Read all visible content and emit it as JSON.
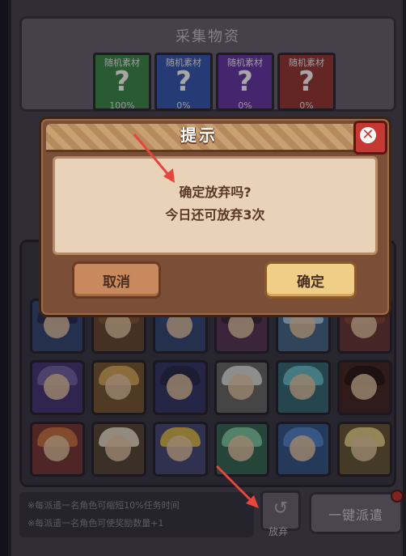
{
  "header": {
    "title": "采集物资",
    "materials": [
      {
        "label": "随机素材",
        "percent": "100%",
        "color": "#3f8a4e"
      },
      {
        "label": "随机素材",
        "percent": "0%",
        "color": "#3b59b5"
      },
      {
        "label": "随机素材",
        "percent": "0%",
        "color": "#6a3aa8"
      },
      {
        "label": "随机素材",
        "percent": "0%",
        "color": "#9a3a3a"
      }
    ]
  },
  "dialog": {
    "title": "提示",
    "message": "确定放弃吗?",
    "sub_message": "今日还可放弃3次",
    "cancel_label": "取消",
    "confirm_label": "确定"
  },
  "footer": {
    "notes": [
      "※每派遣一名角色可缩短10%任务时间",
      "※每派遣一名角色可使奖励数量+1"
    ],
    "abandon_label": "放弃",
    "dispatch_label": "一键派遣"
  },
  "colors": {
    "accent_arrow": "#e8453f"
  }
}
